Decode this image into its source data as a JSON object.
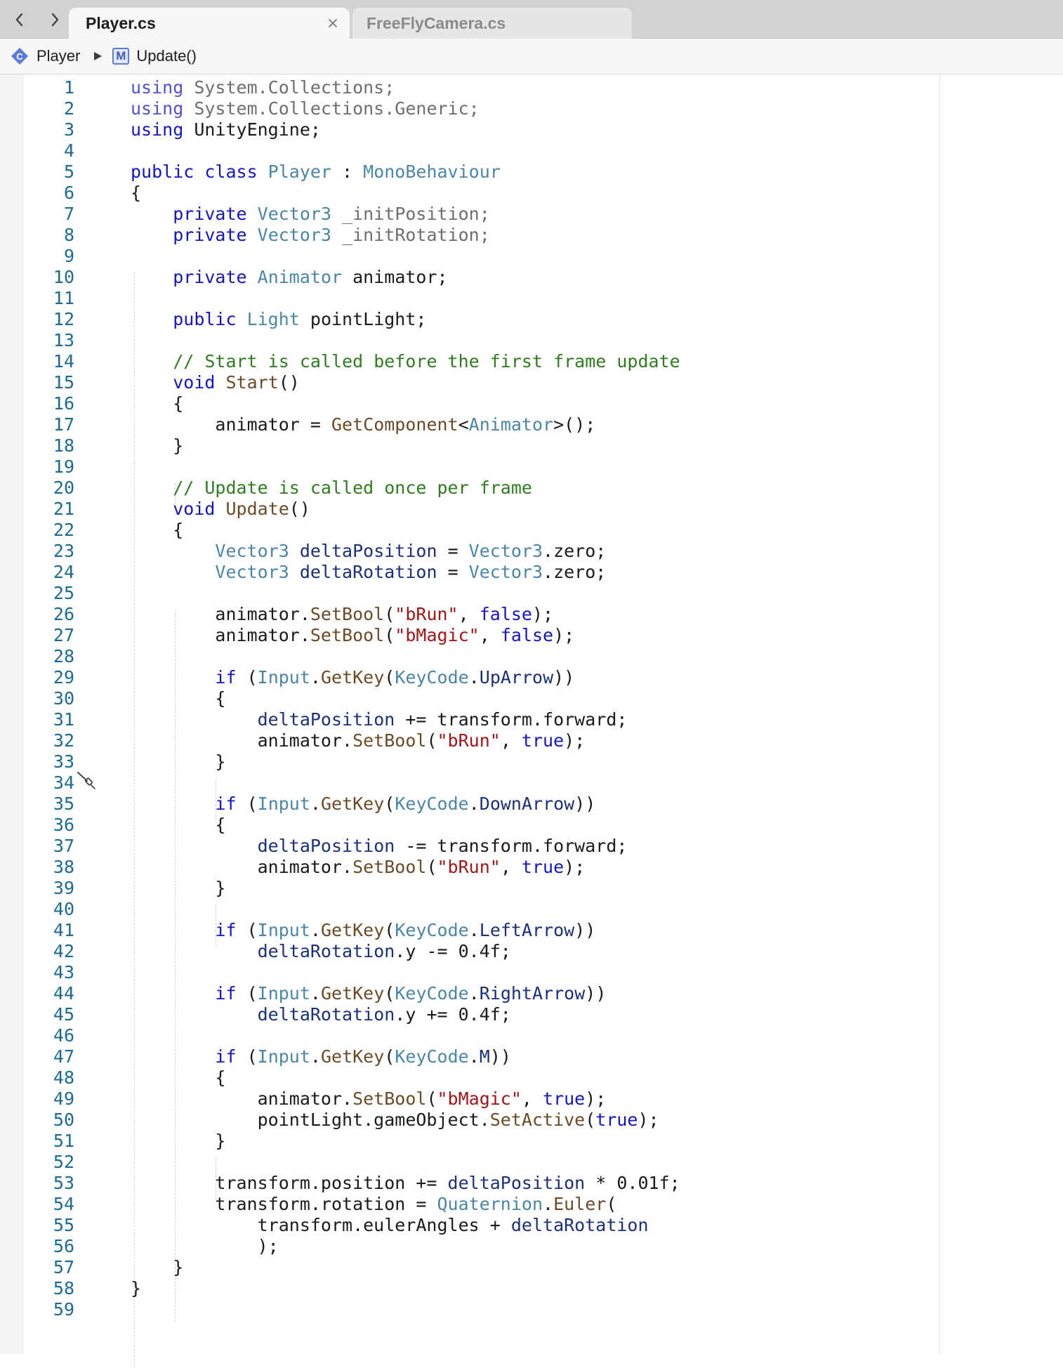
{
  "nav": {
    "back_icon": "chevron-left-icon",
    "forward_icon": "chevron-right-icon"
  },
  "tabs": [
    {
      "label": "Player.cs",
      "active": true
    },
    {
      "label": "FreeFlyCamera.cs",
      "active": false
    }
  ],
  "breadcrumb": {
    "class_label": "Player",
    "method_badge": "M",
    "method_label": "Update()"
  },
  "colors": {
    "keyword": "#1414c8",
    "type": "#4a86a8",
    "method": "#6b4a26",
    "string": "#a31515",
    "comment": "#2e7d1f",
    "local": "#1c2f7d",
    "line_number": "#1b6a94"
  },
  "editor": {
    "code_lines": [
      [
        [
          "use",
          "using "
        ],
        [
          "ns",
          "System.Collections;"
        ]
      ],
      [
        [
          "use",
          "using "
        ],
        [
          "ns",
          "System.Collections.Generic;"
        ]
      ],
      [
        [
          "kw",
          "using "
        ],
        [
          "plain",
          "UnityEngine;"
        ]
      ],
      [],
      [
        [
          "kw",
          "public class "
        ],
        [
          "type",
          "Player"
        ],
        [
          "plain",
          " : "
        ],
        [
          "type",
          "MonoBehaviour"
        ]
      ],
      [
        [
          "plain",
          "{"
        ]
      ],
      [
        [
          "plain",
          "    "
        ],
        [
          "kw",
          "private "
        ],
        [
          "type",
          "Vector3 "
        ],
        [
          "ns",
          "_initPosition;"
        ]
      ],
      [
        [
          "plain",
          "    "
        ],
        [
          "kw",
          "private "
        ],
        [
          "type",
          "Vector3 "
        ],
        [
          "ns",
          "_initRotation;"
        ]
      ],
      [],
      [
        [
          "plain",
          "    "
        ],
        [
          "kw",
          "private "
        ],
        [
          "type",
          "Animator "
        ],
        [
          "plain",
          "animator;"
        ]
      ],
      [],
      [
        [
          "plain",
          "    "
        ],
        [
          "kw",
          "public "
        ],
        [
          "type",
          "Light "
        ],
        [
          "plain",
          "pointLight;"
        ]
      ],
      [],
      [
        [
          "plain",
          "    "
        ],
        [
          "comment",
          "// Start is called before the first frame update"
        ]
      ],
      [
        [
          "plain",
          "    "
        ],
        [
          "kw",
          "void "
        ],
        [
          "method",
          "Start"
        ],
        [
          "plain",
          "()"
        ]
      ],
      [
        [
          "plain",
          "    {"
        ]
      ],
      [
        [
          "plain",
          "        animator = "
        ],
        [
          "method",
          "GetComponent"
        ],
        [
          "plain",
          "<"
        ],
        [
          "type",
          "Animator"
        ],
        [
          "plain",
          ">();"
        ]
      ],
      [
        [
          "plain",
          "    }"
        ]
      ],
      [],
      [
        [
          "plain",
          "    "
        ],
        [
          "comment",
          "// Update is called once per frame"
        ]
      ],
      [
        [
          "plain",
          "    "
        ],
        [
          "kw",
          "void "
        ],
        [
          "method",
          "Update"
        ],
        [
          "plain",
          "()"
        ]
      ],
      [
        [
          "plain",
          "    {"
        ]
      ],
      [
        [
          "plain",
          "        "
        ],
        [
          "type",
          "Vector3 "
        ],
        [
          "local",
          "deltaPosition"
        ],
        [
          "plain",
          " = "
        ],
        [
          "type",
          "Vector3"
        ],
        [
          "plain",
          ".zero;"
        ]
      ],
      [
        [
          "plain",
          "        "
        ],
        [
          "type",
          "Vector3 "
        ],
        [
          "local",
          "deltaRotation"
        ],
        [
          "plain",
          " = "
        ],
        [
          "type",
          "Vector3"
        ],
        [
          "plain",
          ".zero;"
        ]
      ],
      [],
      [
        [
          "plain",
          "        animator."
        ],
        [
          "method",
          "SetBool"
        ],
        [
          "plain",
          "("
        ],
        [
          "str",
          "\"bRun\""
        ],
        [
          "plain",
          ", "
        ],
        [
          "kw",
          "false"
        ],
        [
          "plain",
          ");"
        ]
      ],
      [
        [
          "plain",
          "        animator."
        ],
        [
          "method",
          "SetBool"
        ],
        [
          "plain",
          "("
        ],
        [
          "str",
          "\"bMagic\""
        ],
        [
          "plain",
          ", "
        ],
        [
          "kw",
          "false"
        ],
        [
          "plain",
          ");"
        ]
      ],
      [],
      [
        [
          "plain",
          "        "
        ],
        [
          "kw",
          "if "
        ],
        [
          "plain",
          "("
        ],
        [
          "type",
          "Input"
        ],
        [
          "plain",
          "."
        ],
        [
          "method",
          "GetKey"
        ],
        [
          "plain",
          "("
        ],
        [
          "type",
          "KeyCode"
        ],
        [
          "plain",
          "."
        ],
        [
          "local",
          "UpArrow"
        ],
        [
          "plain",
          "))"
        ]
      ],
      [
        [
          "plain",
          "        {"
        ]
      ],
      [
        [
          "plain",
          "            "
        ],
        [
          "local",
          "deltaPosition"
        ],
        [
          "plain",
          " += transform.forward;"
        ]
      ],
      [
        [
          "plain",
          "            animator."
        ],
        [
          "method",
          "SetBool"
        ],
        [
          "plain",
          "("
        ],
        [
          "str",
          "\"bRun\""
        ],
        [
          "plain",
          ", "
        ],
        [
          "kw",
          "true"
        ],
        [
          "plain",
          ");"
        ]
      ],
      [
        [
          "plain",
          "        }"
        ]
      ],
      [],
      [
        [
          "plain",
          "        "
        ],
        [
          "kw",
          "if "
        ],
        [
          "plain",
          "("
        ],
        [
          "type",
          "Input"
        ],
        [
          "plain",
          "."
        ],
        [
          "method",
          "GetKey"
        ],
        [
          "plain",
          "("
        ],
        [
          "type",
          "KeyCode"
        ],
        [
          "plain",
          "."
        ],
        [
          "local",
          "DownArrow"
        ],
        [
          "plain",
          "))"
        ]
      ],
      [
        [
          "plain",
          "        {"
        ]
      ],
      [
        [
          "plain",
          "            "
        ],
        [
          "local",
          "deltaPosition"
        ],
        [
          "plain",
          " -= transform.forward;"
        ]
      ],
      [
        [
          "plain",
          "            animator."
        ],
        [
          "method",
          "SetBool"
        ],
        [
          "plain",
          "("
        ],
        [
          "str",
          "\"bRun\""
        ],
        [
          "plain",
          ", "
        ],
        [
          "kw",
          "true"
        ],
        [
          "plain",
          ");"
        ]
      ],
      [
        [
          "plain",
          "        }"
        ]
      ],
      [],
      [
        [
          "plain",
          "        "
        ],
        [
          "kw",
          "if "
        ],
        [
          "plain",
          "("
        ],
        [
          "type",
          "Input"
        ],
        [
          "plain",
          "."
        ],
        [
          "method",
          "GetKey"
        ],
        [
          "plain",
          "("
        ],
        [
          "type",
          "KeyCode"
        ],
        [
          "plain",
          "."
        ],
        [
          "local",
          "LeftArrow"
        ],
        [
          "plain",
          "))"
        ]
      ],
      [
        [
          "plain",
          "            "
        ],
        [
          "local",
          "deltaRotation"
        ],
        [
          "plain",
          ".y -= 0.4f;"
        ]
      ],
      [],
      [
        [
          "plain",
          "        "
        ],
        [
          "kw",
          "if "
        ],
        [
          "plain",
          "("
        ],
        [
          "type",
          "Input"
        ],
        [
          "plain",
          "."
        ],
        [
          "method",
          "GetKey"
        ],
        [
          "plain",
          "("
        ],
        [
          "type",
          "KeyCode"
        ],
        [
          "plain",
          "."
        ],
        [
          "local",
          "RightArrow"
        ],
        [
          "plain",
          "))"
        ]
      ],
      [
        [
          "plain",
          "            "
        ],
        [
          "local",
          "deltaRotation"
        ],
        [
          "plain",
          ".y += 0.4f;"
        ]
      ],
      [],
      [
        [
          "plain",
          "        "
        ],
        [
          "kw",
          "if "
        ],
        [
          "plain",
          "("
        ],
        [
          "type",
          "Input"
        ],
        [
          "plain",
          "."
        ],
        [
          "method",
          "GetKey"
        ],
        [
          "plain",
          "("
        ],
        [
          "type",
          "KeyCode"
        ],
        [
          "plain",
          "."
        ],
        [
          "local",
          "M"
        ],
        [
          "plain",
          "))"
        ]
      ],
      [
        [
          "plain",
          "        {"
        ]
      ],
      [
        [
          "plain",
          "            animator."
        ],
        [
          "method",
          "SetBool"
        ],
        [
          "plain",
          "("
        ],
        [
          "str",
          "\"bMagic\""
        ],
        [
          "plain",
          ", "
        ],
        [
          "kw",
          "true"
        ],
        [
          "plain",
          ");"
        ]
      ],
      [
        [
          "plain",
          "            pointLight.gameObject."
        ],
        [
          "method",
          "SetActive"
        ],
        [
          "plain",
          "("
        ],
        [
          "kw",
          "true"
        ],
        [
          "plain",
          ");"
        ]
      ],
      [
        [
          "plain",
          "        }"
        ]
      ],
      [],
      [
        [
          "plain",
          "        transform.position += "
        ],
        [
          "local",
          "deltaPosition"
        ],
        [
          "plain",
          " * 0.01f;"
        ]
      ],
      [
        [
          "plain",
          "        transform.rotation = "
        ],
        [
          "type",
          "Quaternion"
        ],
        [
          "plain",
          "."
        ],
        [
          "method",
          "Euler"
        ],
        [
          "plain",
          "("
        ]
      ],
      [
        [
          "plain",
          "            transform.eulerAngles + "
        ],
        [
          "local",
          "deltaRotation"
        ]
      ],
      [
        [
          "plain",
          "            );"
        ]
      ],
      [
        [
          "plain",
          "    }"
        ]
      ],
      [
        [
          "plain",
          "}"
        ]
      ],
      []
    ]
  }
}
